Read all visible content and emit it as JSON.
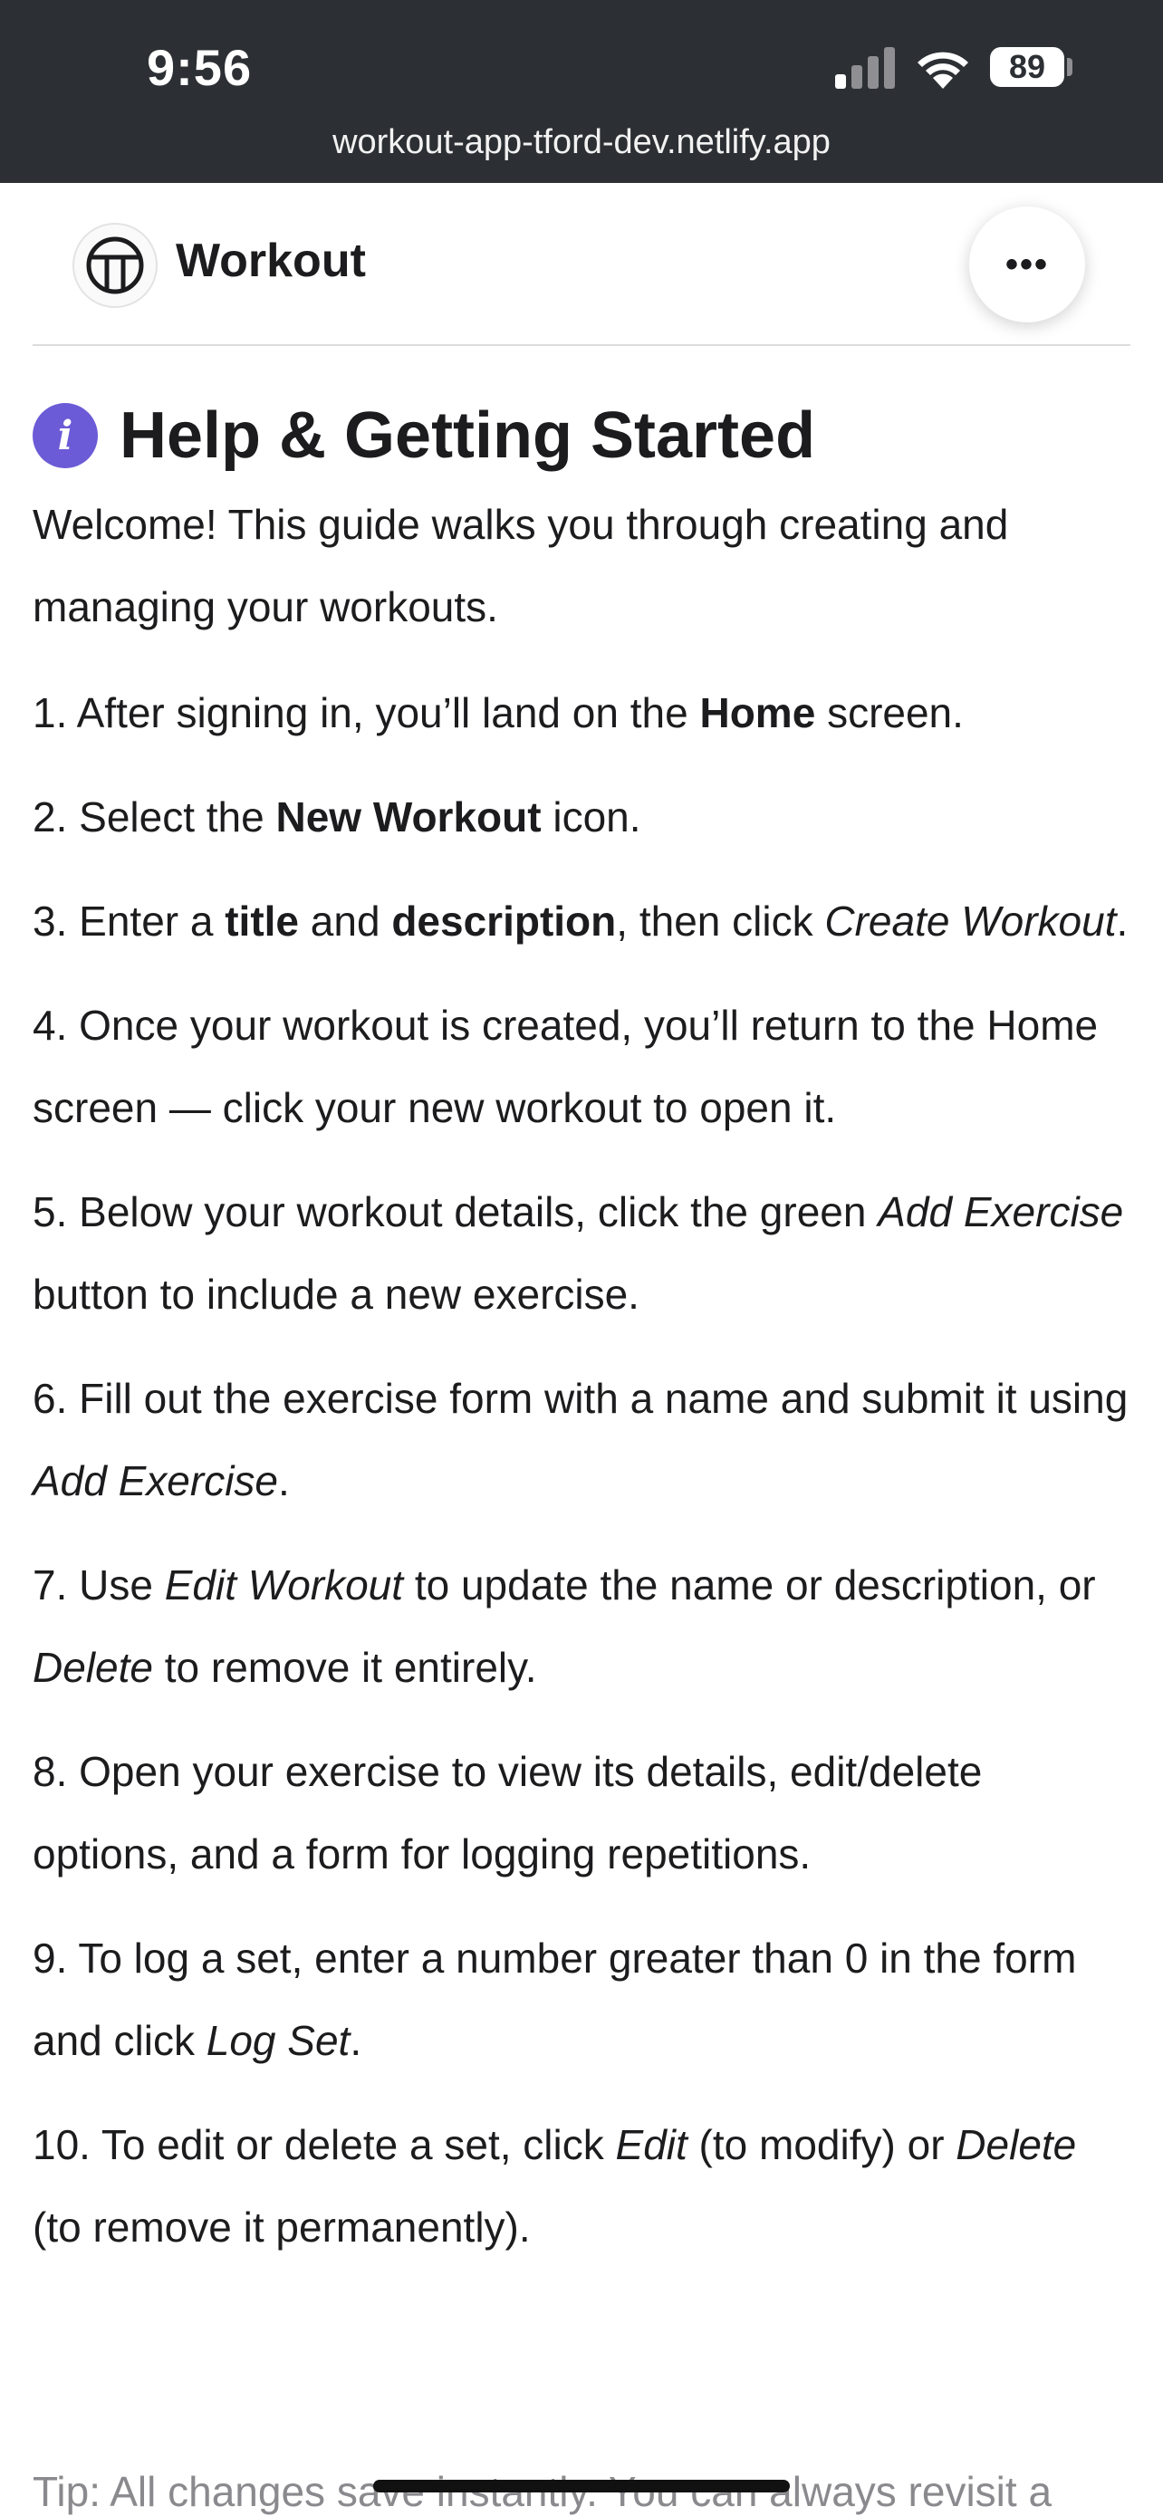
{
  "status_bar": {
    "time": "9:56",
    "battery": "89",
    "url": "workout-app-tford-dev.netlify.app"
  },
  "header": {
    "title": "Workout",
    "menu_icon": "ellipsis-icon",
    "menu_label": "•••"
  },
  "help": {
    "icon_glyph": "i",
    "title": "Help & Getting Started",
    "intro": "Welcome! This guide walks you through creating and managing your workouts.",
    "steps": [
      [
        {
          "t": "1. After signing in, you’ll land on the "
        },
        {
          "t": "Home",
          "s": "b"
        },
        {
          "t": " screen."
        }
      ],
      [
        {
          "t": "2. Select the "
        },
        {
          "t": "New Workout",
          "s": "b"
        },
        {
          "t": " icon."
        }
      ],
      [
        {
          "t": "3. Enter a "
        },
        {
          "t": "title",
          "s": "b"
        },
        {
          "t": " and "
        },
        {
          "t": "description",
          "s": "b"
        },
        {
          "t": ", then click "
        },
        {
          "t": "Create Workout",
          "s": "i"
        },
        {
          "t": "."
        }
      ],
      [
        {
          "t": "4. Once your workout is created, you’ll return to the Home screen — click your new workout to open it."
        }
      ],
      [
        {
          "t": "5. Below your workout details, click the green "
        },
        {
          "t": "Add Exercise",
          "s": "i"
        },
        {
          "t": " button to include a new exercise."
        }
      ],
      [
        {
          "t": "6. Fill out the exercise form with a name and submit it using "
        },
        {
          "t": "Add Exercise",
          "s": "i"
        },
        {
          "t": "."
        }
      ],
      [
        {
          "t": "7. Use "
        },
        {
          "t": "Edit Workout",
          "s": "i"
        },
        {
          "t": " to update the name or description, or "
        },
        {
          "t": "Delete",
          "s": "i"
        },
        {
          "t": " to remove it entirely."
        }
      ],
      [
        {
          "t": "8. Open your exercise to view its details, edit/delete options, and a form for logging repetitions."
        }
      ],
      [
        {
          "t": "9. To log a set, enter a number greater than 0 in the form and click "
        },
        {
          "t": "Log Set",
          "s": "i"
        },
        {
          "t": "."
        }
      ],
      [
        {
          "t": "10. To edit or delete a set, click "
        },
        {
          "t": "Edit",
          "s": "i"
        },
        {
          "t": " (to modify) or "
        },
        {
          "t": "Delete",
          "s": "i"
        },
        {
          "t": " (to remove it permanently)."
        }
      ]
    ],
    "tip": "Tip: All changes save instantly. You can always revisit a"
  },
  "colors": {
    "status_bar_bg": "#2c2f33",
    "info_icon": "#6b5bd6",
    "text": "#1c1c1e"
  }
}
